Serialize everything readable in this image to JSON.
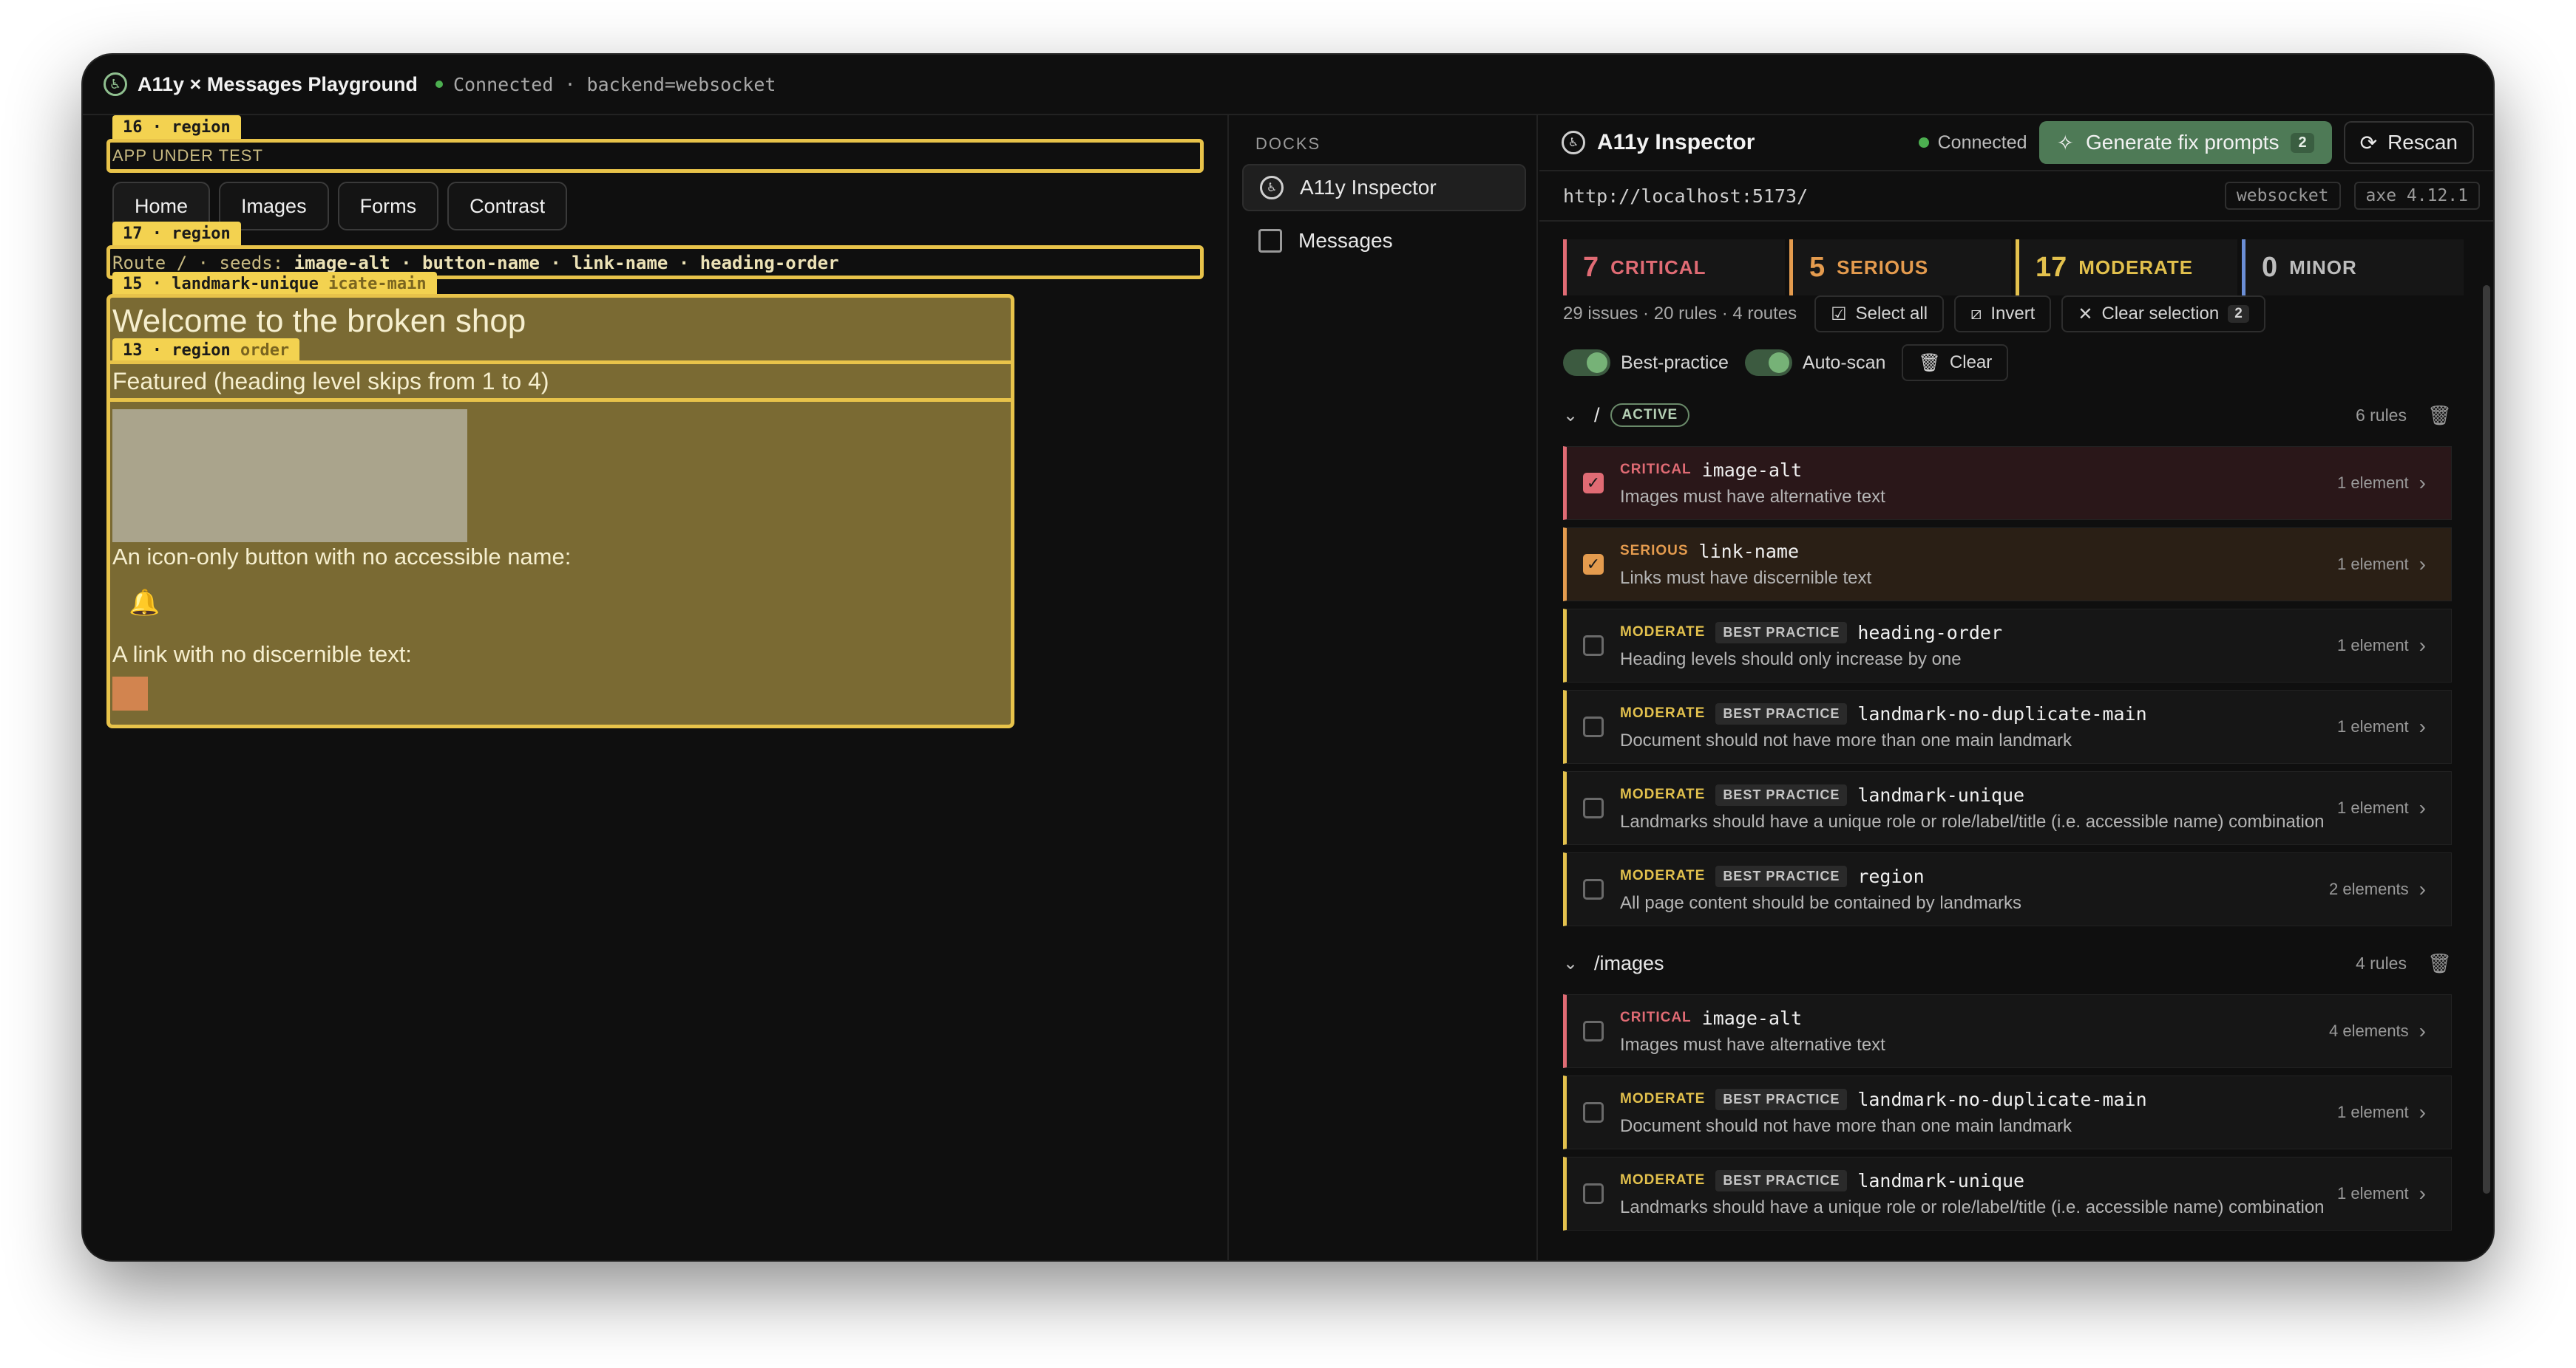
{
  "window": {
    "title": "A11y × Messages Playground",
    "status": "Connected · backend=websocket"
  },
  "app_under_test": {
    "badges": {
      "region16": "16 · region",
      "region17": "17 · region",
      "landmark15": "15 · landmark-unique",
      "landmark15_extra": "icate-main",
      "region13": "13 · region",
      "region13_extra": "order"
    },
    "label": "APP UNDER TEST",
    "tabs": [
      "Home",
      "Images",
      "Forms",
      "Contrast"
    ],
    "route_prefix": "Route / · seeds: ",
    "route_seeds": "image-alt · button-name · link-name · heading-order",
    "heading": "Welcome to the broken shop",
    "featured": "Featured (heading level skips from 1 to 4)",
    "icon_button_text": "An icon-only button with no accessible name:",
    "bell_glyph": "🔔",
    "link_text": "A link with no discernible text:"
  },
  "docks": {
    "label": "DOCKS",
    "items": [
      "A11y Inspector",
      "Messages"
    ]
  },
  "inspector": {
    "title": "A11y Inspector",
    "connection": "Connected",
    "generate_label": "Generate fix prompts",
    "generate_count": "2",
    "rescan_label": "Rescan",
    "url": "http://localhost:5173/",
    "chip_backend": "websocket",
    "chip_axe": "axe 4.12.1",
    "summary": [
      {
        "num": "7",
        "label": "CRITICAL",
        "color": "#e06b74"
      },
      {
        "num": "5",
        "label": "SERIOUS",
        "color": "#e49b4e"
      },
      {
        "num": "17",
        "label": "MODERATE",
        "color": "#e3c14d"
      },
      {
        "num": "0",
        "label": "MINOR",
        "color": "#6b8ed6"
      }
    ],
    "stats": "29 issues · 20 rules · 4 routes",
    "select_all": "Select all",
    "invert": "Invert",
    "clear_selection": "Clear selection",
    "clear_selection_count": "2",
    "toggle_best_practice": "Best-practice",
    "toggle_auto_scan": "Auto-scan",
    "clear": "Clear",
    "groups": [
      {
        "route": "/",
        "active_label": "ACTIVE",
        "rules": "6 rules",
        "issues": [
          {
            "sev": "CRITICAL",
            "bp": "",
            "rule": "image-alt",
            "desc": "Images must have alternative text",
            "count": "1 element"
          },
          {
            "sev": "SERIOUS",
            "bp": "",
            "rule": "link-name",
            "desc": "Links must have discernible text",
            "count": "1 element"
          },
          {
            "sev": "MODERATE",
            "bp": "BEST PRACTICE",
            "rule": "heading-order",
            "desc": "Heading levels should only increase by one",
            "count": "1 element"
          },
          {
            "sev": "MODERATE",
            "bp": "BEST PRACTICE",
            "rule": "landmark-no-duplicate-main",
            "desc": "Document should not have more than one main landmark",
            "count": "1 element"
          },
          {
            "sev": "MODERATE",
            "bp": "BEST PRACTICE",
            "rule": "landmark-unique",
            "desc": "Landmarks should have a unique role or role/label/title (i.e. accessible name) combination",
            "count": "1 element"
          },
          {
            "sev": "MODERATE",
            "bp": "BEST PRACTICE",
            "rule": "region",
            "desc": "All page content should be contained by landmarks",
            "count": "2 elements"
          }
        ]
      },
      {
        "route": "/images",
        "rules": "4 rules",
        "issues": [
          {
            "sev": "CRITICAL",
            "bp": "",
            "rule": "image-alt",
            "desc": "Images must have alternative text",
            "count": "4 elements"
          },
          {
            "sev": "MODERATE",
            "bp": "BEST PRACTICE",
            "rule": "landmark-no-duplicate-main",
            "desc": "Document should not have more than one main landmark",
            "count": "1 element"
          },
          {
            "sev": "MODERATE",
            "bp": "BEST PRACTICE",
            "rule": "landmark-unique",
            "desc": "Landmarks should have a unique role or role/label/title (i.e. accessible name) combination",
            "count": "1 element"
          }
        ]
      }
    ]
  }
}
